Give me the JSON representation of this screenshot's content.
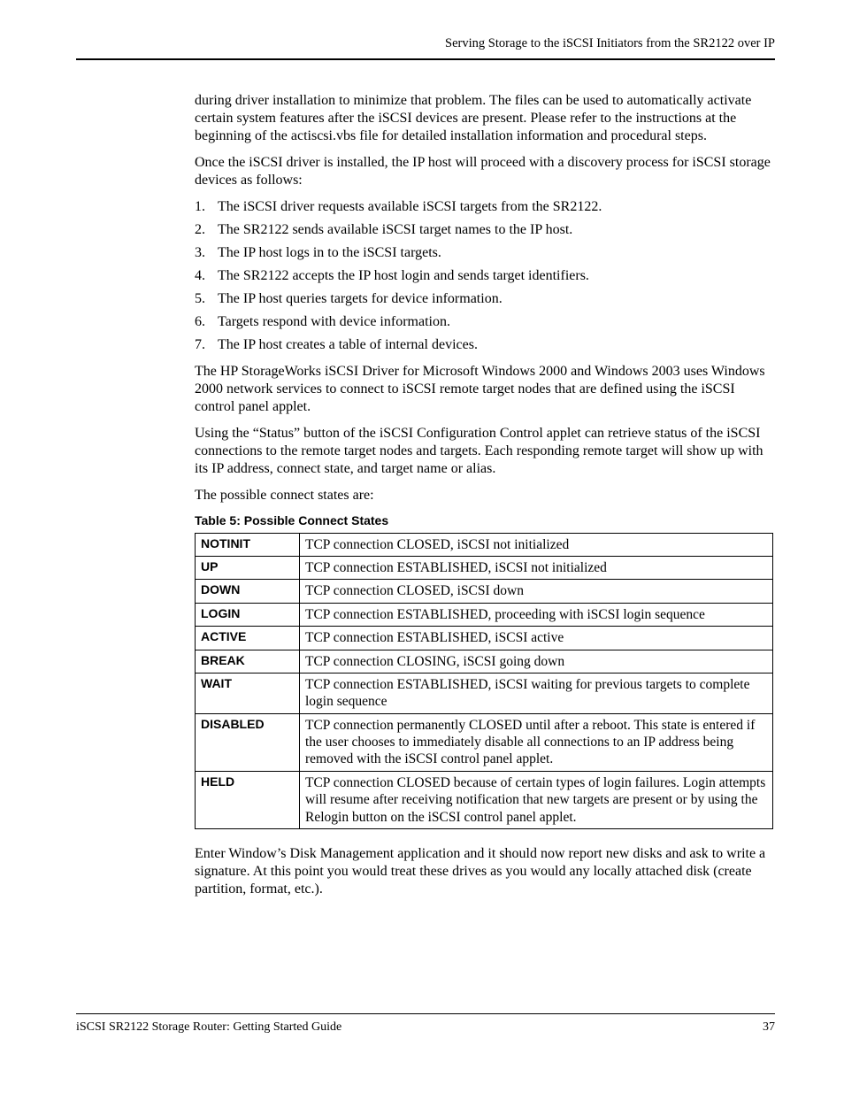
{
  "header": {
    "running_title": "Serving Storage to the iSCSI Initiators from the SR2122 over IP"
  },
  "body": {
    "p1": "during driver installation to minimize that problem. The files can be used to automatically activate certain system features after the iSCSI devices are present. Please refer to the instructions at the beginning of the actiscsi.vbs file for detailed installation information and procedural steps.",
    "p2": "Once the iSCSI driver is installed, the IP host will proceed with a discovery process for iSCSI storage devices as follows:",
    "steps": [
      "The iSCSI driver requests available iSCSI targets from the SR2122.",
      "The SR2122 sends available iSCSI target names to the IP host.",
      "The IP host logs in to the iSCSI targets.",
      "The SR2122 accepts the IP host login and sends target identifiers.",
      "The IP host queries targets for device information.",
      "Targets respond with device information.",
      "The IP host creates a table of internal devices."
    ],
    "p3": " The HP StorageWorks iSCSI Driver for Microsoft Windows 2000 and Windows 2003 uses Windows 2000 network services to connect to iSCSI remote target nodes that are defined using the iSCSI control panel applet.",
    "p4": "Using the “Status” button of the iSCSI Configuration Control applet can retrieve status of the iSCSI connections to the remote target nodes and targets. Each responding remote target will show up with its IP address, connect state, and target name or alias.",
    "p5": "The possible connect states are:",
    "table_caption": "Table 5:  Possible Connect States",
    "table_rows": [
      {
        "state": "NOTINIT",
        "desc": "TCP connection CLOSED, iSCSI not initialized"
      },
      {
        "state": "UP",
        "desc": "TCP connection ESTABLISHED, iSCSI not initialized"
      },
      {
        "state": "DOWN",
        "desc": "TCP connection CLOSED, iSCSI down"
      },
      {
        "state": "LOGIN",
        "desc": "TCP connection ESTABLISHED, proceeding with iSCSI login sequence"
      },
      {
        "state": "ACTIVE",
        "desc": "TCP connection ESTABLISHED, iSCSI active"
      },
      {
        "state": "BREAK",
        "desc": "TCP connection CLOSING, iSCSI going down"
      },
      {
        "state": "WAIT",
        "desc": "TCP connection ESTABLISHED, iSCSI waiting for previous targets to complete login sequence"
      },
      {
        "state": "DISABLED",
        "desc": "TCP connection permanently CLOSED until after a reboot. This state is entered if the user chooses to immediately disable all connections to an IP address being removed with the iSCSI control panel applet."
      },
      {
        "state": "HELD",
        "desc": "TCP connection CLOSED because of certain types of login failures. Login attempts will resume after receiving notification that new targets are present or by using the Relogin button on the iSCSI control panel applet."
      }
    ],
    "p6": "Enter Window’s Disk Management application and it should now report new disks and ask to write a signature. At this point you would treat these drives as you would any locally attached disk (create partition, format, etc.)."
  },
  "footer": {
    "doc_title": "iSCSI SR2122 Storage Router: Getting Started Guide",
    "page_number": "37"
  }
}
